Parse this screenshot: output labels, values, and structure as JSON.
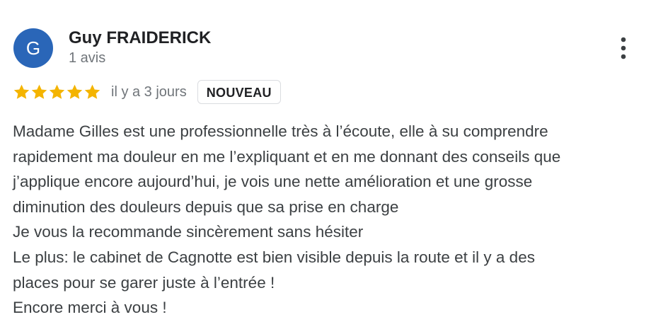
{
  "review": {
    "author": {
      "initial": "G",
      "name": "Guy FRAIDERICK",
      "review_count": "1 avis",
      "avatar_color": "#2a66b8"
    },
    "more_icon": "more-vert-icon",
    "rating": {
      "stars": 5,
      "max_stars": 5,
      "star_color": "#f4b400",
      "date": "il y a 3 jours",
      "badge": "NOUVEAU"
    },
    "text_lines": [
      "Madame Gilles est une professionnelle très à l’écoute, elle à su comprendre",
      "rapidement ma douleur en me l’expliquant et en me donnant des conseils que",
      "j’applique encore aujourd’hui, je vois une nette amélioration et une grosse",
      "diminution des douleurs depuis que sa prise en charge",
      "Je vous la recommande sincèrement sans hésiter",
      "Le plus: le cabinet de Cagnotte est bien visible depuis la route et il y a des",
      "places pour se garer juste à l’entrée !",
      "Encore merci à vous !"
    ]
  }
}
